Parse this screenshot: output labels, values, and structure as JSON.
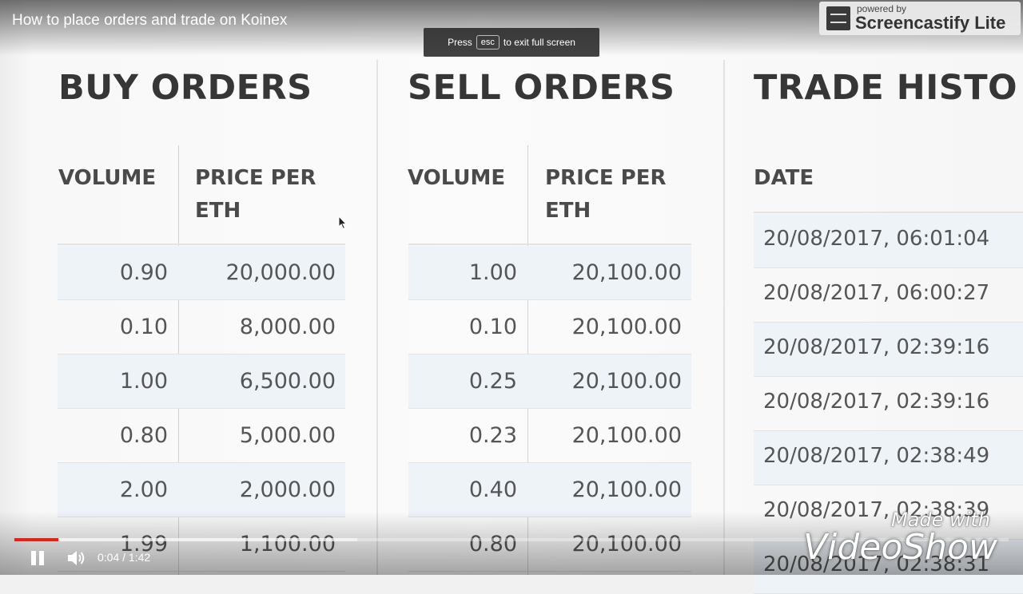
{
  "video": {
    "title": "How to place orders and trade on Koinex",
    "fullscreen_hint_pre": "Press",
    "fullscreen_hint_key": "esc",
    "fullscreen_hint_post": "to exit full screen",
    "elapsed": "0:04",
    "duration": "1:42",
    "time_separator": " / ",
    "progress_fraction": 0.0441,
    "buffered_fraction": 0.345
  },
  "recorder_badge": {
    "powered": "powered by",
    "name": "Screencastify Lite"
  },
  "watermark": {
    "made_with": "Made with",
    "brand": "VideoShow"
  },
  "buy_orders": {
    "title": "BUY ORDERS",
    "headers": {
      "volume": "VOLUME",
      "price": "PRICE PER\nETH"
    },
    "rows": [
      {
        "volume": "0.90",
        "price": "20,000.00"
      },
      {
        "volume": "0.10",
        "price": "8,000.00"
      },
      {
        "volume": "1.00",
        "price": "6,500.00"
      },
      {
        "volume": "0.80",
        "price": "5,000.00"
      },
      {
        "volume": "2.00",
        "price": "2,000.00"
      },
      {
        "volume": "1.99",
        "price": "1,100.00"
      }
    ]
  },
  "sell_orders": {
    "title": "SELL ORDERS",
    "headers": {
      "volume": "VOLUME",
      "price": "PRICE PER\nETH"
    },
    "rows": [
      {
        "volume": "1.00",
        "price": "20,100.00"
      },
      {
        "volume": "0.10",
        "price": "20,100.00"
      },
      {
        "volume": "0.25",
        "price": "20,100.00"
      },
      {
        "volume": "0.23",
        "price": "20,100.00"
      },
      {
        "volume": "0.40",
        "price": "20,100.00"
      },
      {
        "volume": "0.80",
        "price": "20,100.00"
      }
    ]
  },
  "trade_history": {
    "title": "TRADE HISTO",
    "headers": {
      "date": "DATE"
    },
    "rows": [
      "20/08/2017, 06:01:04",
      "20/08/2017, 06:00:27",
      "20/08/2017, 02:39:16",
      "20/08/2017, 02:39:16",
      "20/08/2017, 02:38:49",
      "20/08/2017, 02:38:39",
      "20/08/2017, 02:38:31"
    ]
  }
}
